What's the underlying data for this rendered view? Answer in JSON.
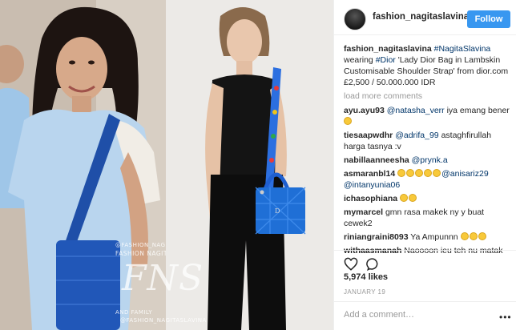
{
  "post": {
    "username": "fashion_nagitaslavina",
    "follow_label": "Follow",
    "caption": {
      "username": "fashion_nagitaslavina",
      "hashtag1": "#NagitaSlavina",
      "text1": " wearing ",
      "hashtag2": "#Dior",
      "text2": " 'Lady Dior Bag in Lambskin Customisable Shoulder Strap' from dior.com £2,500 / 50.000.000 IDR"
    },
    "load_more": "load more comments",
    "comments": [
      {
        "user": "ayu.ayu93",
        "mention": "@natasha_verr",
        "text": " iya emang bener",
        "emojis": 1,
        "emoji_first": false
      },
      {
        "user": "tiesaapwdhr",
        "mention": "@adrifa_99",
        "text": " astaghfirullah harga tasnya :v",
        "emojis": 0,
        "emoji_first": false
      },
      {
        "user": "nabillaanneesha",
        "mention": "@prynk.a",
        "text": "",
        "emojis": 0,
        "emoji_first": false
      },
      {
        "user": "asmaranbl14",
        "mention": "@anisariz29",
        "mention2": "@intanyunia06",
        "text": "",
        "emojis": 5,
        "emoji_first": true
      },
      {
        "user": "ichasophiana",
        "mention": "",
        "text": "",
        "emojis": 2,
        "emoji_first": true
      },
      {
        "user": "mymarcel",
        "mention": "",
        "text": " gmn rasa makek ny y buat cewek2",
        "emojis": 0,
        "emoji_first": false
      },
      {
        "user": "riniangraini8093",
        "mention": "",
        "text": " Ya Ampunnn",
        "emojis": 3,
        "emoji_first": false
      },
      {
        "user": "withaasmanah",
        "mention": "",
        "text": " Naoooon ieu teh nu matak",
        "emojis": 0,
        "emoji_first": false
      }
    ],
    "likes": "5,974 likes",
    "date": "JANUARY 19",
    "add_comment_placeholder": "Add a comment…",
    "more_label": "•••"
  },
  "watermark": {
    "line1": "@FASHION_NAGITASLAVINA",
    "line2": "FASHION NAGITA SLAVINA",
    "big": "FNS",
    "line3": "AND FAMILY",
    "line4": "@FASHION_NAGITASLAVINA"
  },
  "icons": {
    "like": "heart-outline-icon",
    "comment": "speech-bubble-icon",
    "avatar": "profile-avatar"
  },
  "colors": {
    "follow_button": "#3897f0",
    "link": "#003569",
    "muted": "#999999",
    "bag_blue": "#1f6fd6"
  }
}
